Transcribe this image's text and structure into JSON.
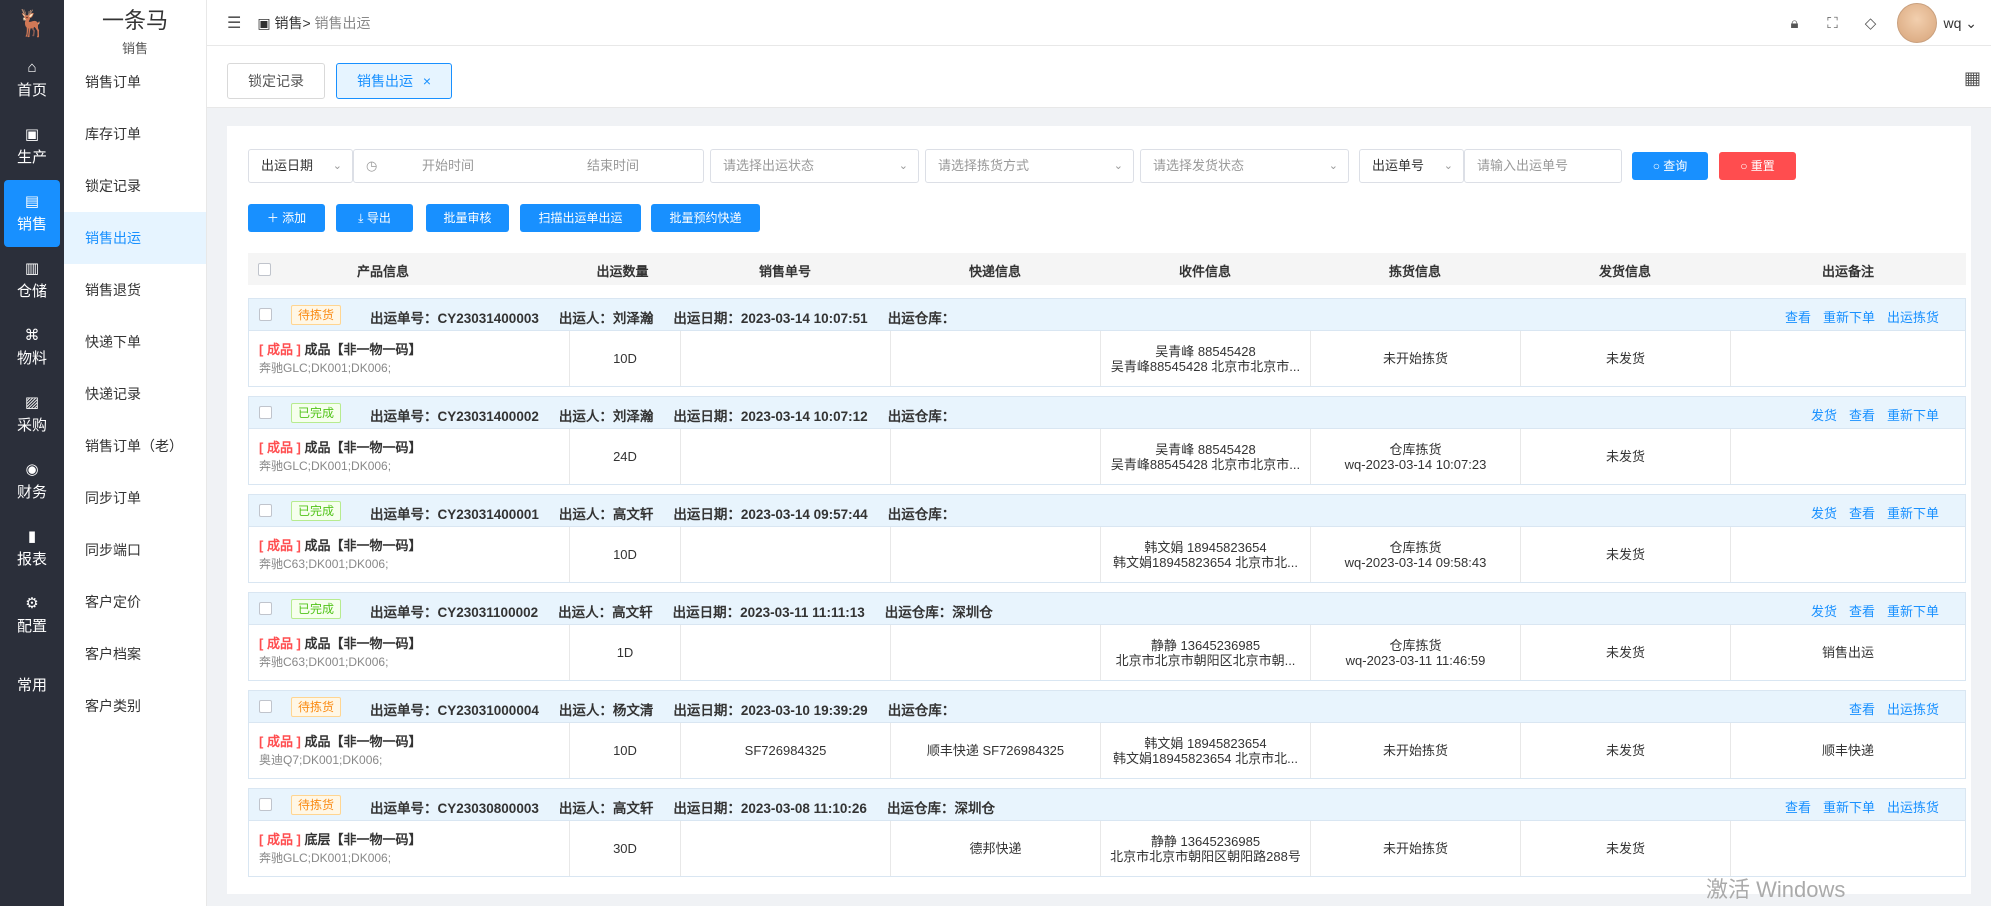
{
  "rail": {
    "logo": "🦌",
    "items": [
      {
        "icon": "⌂",
        "label": "首页"
      },
      {
        "icon": "▣",
        "label": "生产"
      },
      {
        "icon": "▤",
        "label": "销售",
        "active": true
      },
      {
        "icon": "▥",
        "label": "仓储"
      },
      {
        "icon": "⌘",
        "label": "物料"
      },
      {
        "icon": "▨",
        "label": "采购"
      },
      {
        "icon": "◉",
        "label": "财务"
      },
      {
        "icon": "▮",
        "label": "报表"
      },
      {
        "icon": "⚙",
        "label": "配置"
      },
      {
        "icon": "",
        "label": "常用"
      }
    ]
  },
  "sub": {
    "brand": "一条马",
    "section": "销售",
    "items": [
      "销售订单",
      "库存订单",
      "锁定记录",
      "销售出运",
      "销售退货",
      "快递下单",
      "快递记录",
      "销售订单（老）",
      "同步订单",
      "同步端口",
      "客户定价",
      "客户档案",
      "客户类别"
    ]
  },
  "header": {
    "crumb_parent": "销售>",
    "crumb_current": "销售出运",
    "username": "wq"
  },
  "tabs": {
    "t1": "锁定记录",
    "t2": "销售出运",
    "close": "×"
  },
  "filters": {
    "date_type": "出运日期",
    "start": "开始时间",
    "end": "结束时间",
    "status": "请选择出运状态",
    "pick": "请选择拣货方式",
    "ship": "请选择发货状态",
    "no_type": "出运单号",
    "no_placeholder": "请输入出运单号",
    "query": "查询",
    "reset": "重置"
  },
  "actions": {
    "add": "添加",
    "export": "导出",
    "audit": "批量审核",
    "scan": "扫描出运单出运",
    "express": "批量预约快递"
  },
  "columns": [
    "产品信息",
    "出运数量",
    "销售单号",
    "快递信息",
    "收件信息",
    "拣货信息",
    "发货信息",
    "出运备注"
  ],
  "labels": {
    "no": "出运单号：",
    "person": "出运人：",
    "date": "出运日期：",
    "wh": "出运仓库："
  },
  "records": [
    {
      "tag": "待拣货",
      "tag_type": "warn",
      "no": "CY23031400003",
      "person": "刘泽瀚",
      "date": "2023-03-14 10:07:51",
      "wh": "",
      "acts": [
        "查看",
        "重新下单",
        "出运拣货"
      ],
      "prod_type": "[ 成品 ]",
      "prod_name": "成品【非一物一码】",
      "prod_sub": "奔驰GLC;DK001;DK006;",
      "qty": "10D",
      "sale_no": "",
      "express": "",
      "recv1": "吴青峰 88545428",
      "recv2": "吴青峰88545428 北京市北京市...",
      "pick1": "未开始拣货",
      "pick2": "",
      "ship": "未发货",
      "remark": ""
    },
    {
      "tag": "已完成",
      "tag_type": "ok",
      "no": "CY23031400002",
      "person": "刘泽瀚",
      "date": "2023-03-14 10:07:12",
      "wh": "",
      "acts": [
        "发货",
        "查看",
        "重新下单"
      ],
      "prod_type": "[ 成品 ]",
      "prod_name": "成品【非一物一码】",
      "prod_sub": "奔驰GLC;DK001;DK006;",
      "qty": "24D",
      "sale_no": "",
      "express": "",
      "recv1": "吴青峰 88545428",
      "recv2": "吴青峰88545428 北京市北京市...",
      "pick1": "仓库拣货",
      "pick2": "wq-2023-03-14 10:07:23",
      "ship": "未发货",
      "remark": ""
    },
    {
      "tag": "已完成",
      "tag_type": "ok",
      "no": "CY23031400001",
      "person": "高文轩",
      "date": "2023-03-14 09:57:44",
      "wh": "",
      "acts": [
        "发货",
        "查看",
        "重新下单"
      ],
      "prod_type": "[ 成品 ]",
      "prod_name": "成品【非一物一码】",
      "prod_sub": "奔驰C63;DK001;DK006;",
      "qty": "10D",
      "sale_no": "",
      "express": "",
      "recv1": "韩文娟 18945823654",
      "recv2": "韩文娟18945823654 北京市北...",
      "pick1": "仓库拣货",
      "pick2": "wq-2023-03-14 09:58:43",
      "ship": "未发货",
      "remark": ""
    },
    {
      "tag": "已完成",
      "tag_type": "ok",
      "no": "CY23031100002",
      "person": "高文轩",
      "date": "2023-03-11 11:11:13",
      "wh": "深圳仓",
      "acts": [
        "发货",
        "查看",
        "重新下单"
      ],
      "prod_type": "[ 成品 ]",
      "prod_name": "成品【非一物一码】",
      "prod_sub": "奔驰C63;DK001;DK006;",
      "qty": "1D",
      "sale_no": "",
      "express": "",
      "recv1": "静静 13645236985",
      "recv2": "北京市北京市朝阳区北京市朝...",
      "pick1": "仓库拣货",
      "pick2": "wq-2023-03-11 11:46:59",
      "ship": "未发货",
      "remark": "销售出运"
    },
    {
      "tag": "待拣货",
      "tag_type": "warn",
      "no": "CY23031000004",
      "person": "杨文清",
      "date": "2023-03-10 19:39:29",
      "wh": "",
      "acts": [
        "查看",
        "出运拣货"
      ],
      "prod_type": "[ 成品 ]",
      "prod_name": "成品【非一物一码】",
      "prod_sub": "奥迪Q7;DK001;DK006;",
      "qty": "10D",
      "sale_no": "SF726984325",
      "express": "顺丰快递 SF726984325",
      "recv1": "韩文娟 18945823654",
      "recv2": "韩文娟18945823654 北京市北...",
      "pick1": "未开始拣货",
      "pick2": "",
      "ship": "未发货",
      "remark": "顺丰快递"
    },
    {
      "tag": "待拣货",
      "tag_type": "warn",
      "no": "CY23030800003",
      "person": "高文轩",
      "date": "2023-03-08 11:10:26",
      "wh": "深圳仓",
      "acts": [
        "查看",
        "重新下单",
        "出运拣货"
      ],
      "prod_type": "[ 成品 ]",
      "prod_name": "底层【非一物一码】",
      "prod_sub": "奔驰GLC;DK001;DK006;",
      "qty": "30D",
      "sale_no": "",
      "express": "德邦快递",
      "recv1": "静静 13645236985",
      "recv2": "北京市北京市朝阳区朝阳路288号",
      "pick1": "未开始拣货",
      "pick2": "",
      "ship": "未发货",
      "remark": ""
    }
  ],
  "watermark": "激活 Windows"
}
